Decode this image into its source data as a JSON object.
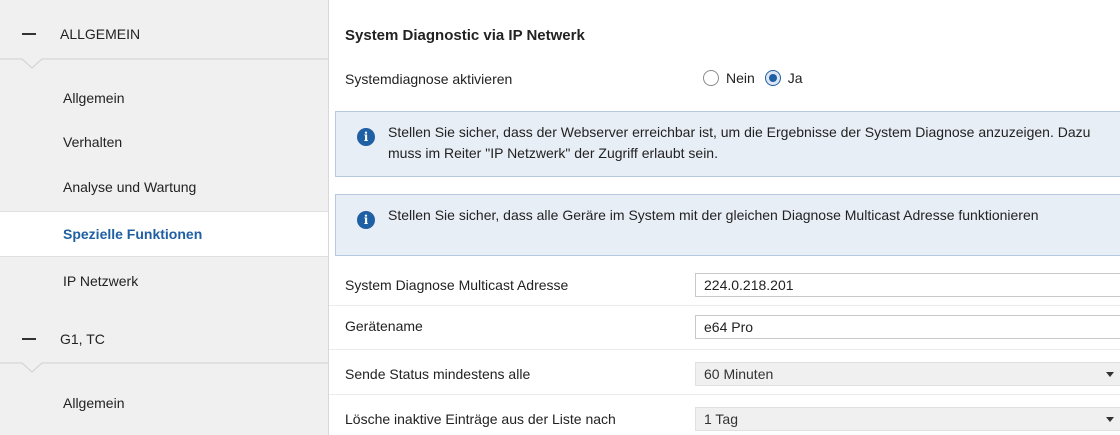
{
  "sidebar": {
    "group1": {
      "label": "ALLGEMEIN"
    },
    "group1_items": [
      {
        "label": "Allgemein"
      },
      {
        "label": "Verhalten"
      },
      {
        "label": "Analyse und Wartung"
      },
      {
        "label": "Spezielle Funktionen"
      },
      {
        "label": "IP Netzwerk"
      }
    ],
    "group2": {
      "label": "G1, TC"
    },
    "group2_items": [
      {
        "label": "Allgemein"
      }
    ]
  },
  "main": {
    "title": "System Diagnostic via IP Netwerk",
    "systemdiagnose": {
      "label": "Systemdiagnose aktivieren",
      "options": [
        "Nein",
        "Ja"
      ],
      "selected": "Ja"
    },
    "info1": "Stellen Sie sicher, dass der Webserver erreichbar ist, um die Ergebnisse der System Diagnose anzuzeigen. Dazu muss im Reiter \"IP Netzwerk\" der Zugriff erlaubt sein.",
    "info2": "Stellen Sie sicher, dass alle Geräre im System mit der gleichen Diagnose Multicast Adresse funktionieren",
    "multicast": {
      "label": "System Diagnose Multicast Adresse",
      "value": "224.0.218.201"
    },
    "geraetename": {
      "label": "Gerätename",
      "value": "e64 Pro"
    },
    "sende_status": {
      "label": "Sende Status mindestens alle",
      "value": "60 Minuten"
    },
    "loesche": {
      "label": "Lösche inaktive Einträge aus der Liste nach",
      "value": "1 Tag"
    }
  },
  "colors": {
    "accent": "#1f5fa3",
    "info_background": "#e8eef6",
    "sidebar_background": "#f0f0f0"
  },
  "icons": {
    "collapse": "minus-icon",
    "info": "info-icon",
    "dropdown": "chevron-down-icon"
  }
}
